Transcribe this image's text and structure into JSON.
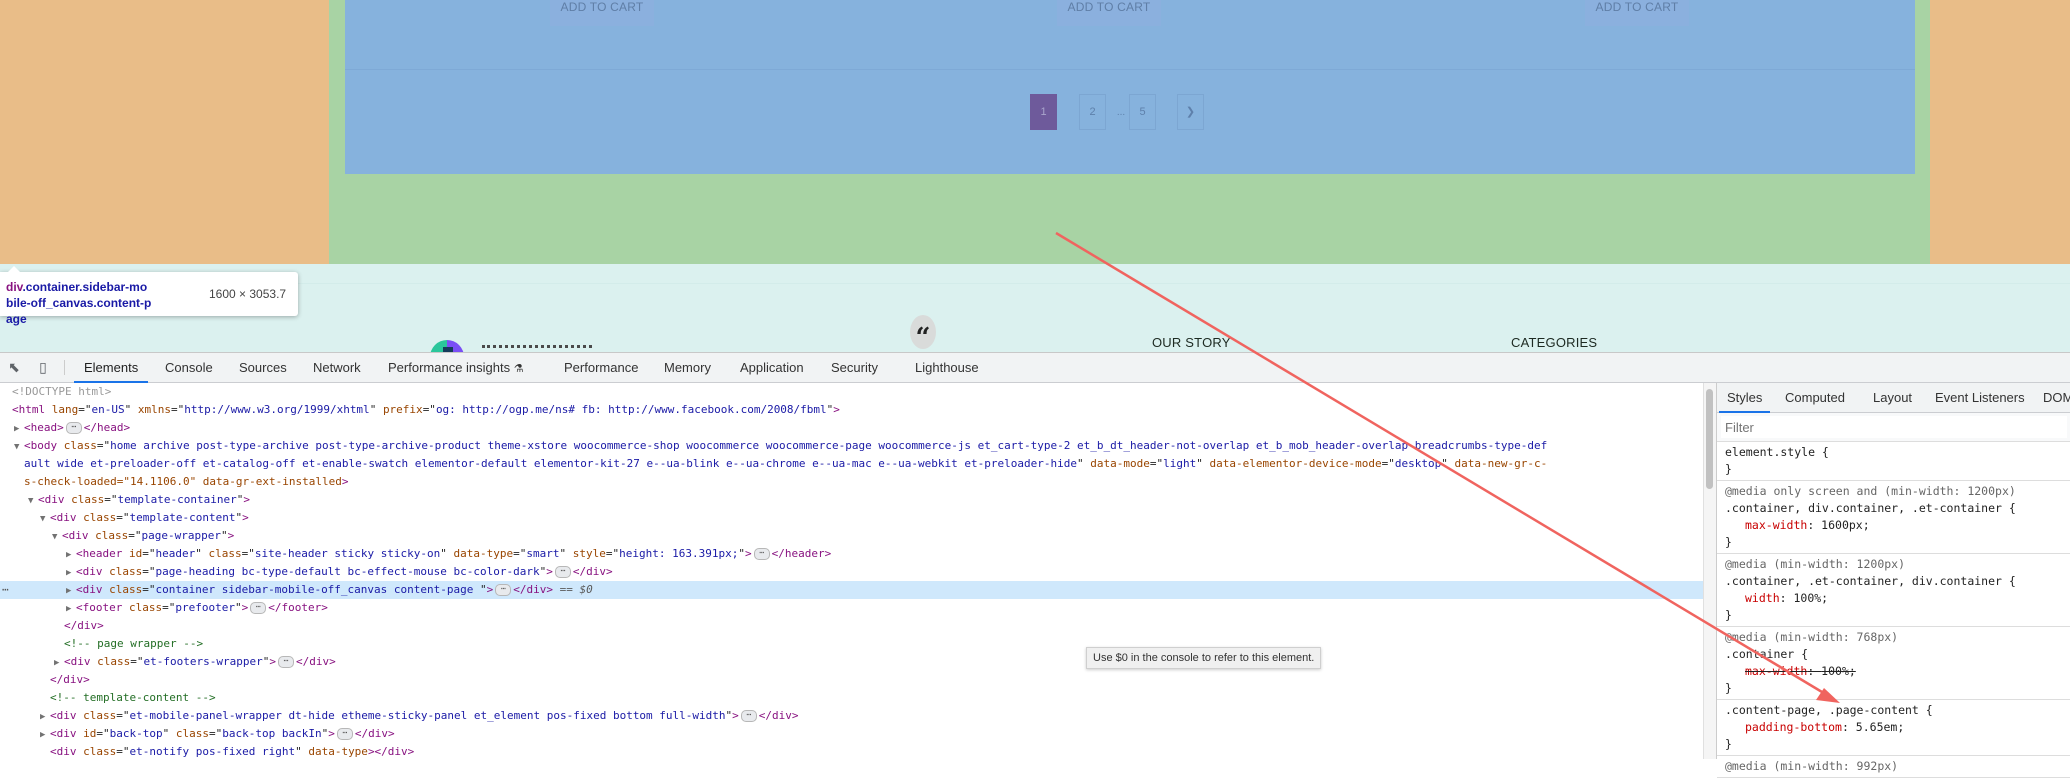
{
  "page": {
    "add_to_cart_label": "ADD TO CART",
    "pagination": {
      "pages": [
        "1",
        "2",
        "5"
      ],
      "ellipsis": "...",
      "current": "1",
      "next_icon": "chevron-right-icon"
    },
    "footer": {
      "quote_icon": "quote-icon",
      "headings": [
        "OUR STORY",
        "CATEGORIES"
      ]
    },
    "box_model_colors": {
      "margin": "#e9bd88",
      "padding": "#a8d3a4",
      "content": "#86b2dd"
    }
  },
  "inspect_tooltip": {
    "tag": "div",
    "classes": ".container.sidebar-mobile-off_canvas.content-page",
    "size": "1600 × 3053.7"
  },
  "devtools": {
    "toolbar_icons": [
      "inspect-element-icon",
      "device-toolbar-icon"
    ],
    "tabs": [
      "Elements",
      "Console",
      "Sources",
      "Network",
      "Performance insights",
      "Performance",
      "Memory",
      "Application",
      "Security",
      "Lighthouse"
    ],
    "active_tab": "Elements",
    "perf_insights_icon": "flask-icon",
    "dom": {
      "doctype": "<!DOCTYPE html>",
      "html_open": {
        "tag": "html",
        "attrs": [
          [
            "lang",
            "en-US"
          ],
          [
            "xmlns",
            "http://www.w3.org/1999/xhtml"
          ],
          [
            "prefix",
            "og: http://ogp.me/ns# fb: http://www.facebook.com/2008/fbml"
          ]
        ]
      },
      "head": "head",
      "body_class_line1": "home archive post-type-archive post-type-archive-product theme-xstore woocommerce-shop woocommerce woocommerce-page woocommerce-js et_cart-type-2 et_b_dt_header-not-overlap et_b_mob_header-overlap breadcrumbs-type-def",
      "body_class_line2": "ault wide et-preloader-off et-catalog-off et-enable-swatch elementor-default elementor-kit-27 e--ua-blink e--ua-chrome e--ua-mac e--ua-webkit et-preloader-hide",
      "body_attrs_line2": [
        [
          "data-mode",
          "light"
        ],
        [
          "data-elementor-device-mode",
          "desktop"
        ],
        [
          "data-new-gr-c-",
          ""
        ]
      ],
      "body_attrs_line3": "s-check-loaded=\"14.1106.0\" data-gr-ext-installed",
      "template_container": "template-container",
      "template_content": "template-content",
      "page_wrapper": "page-wrapper",
      "header": {
        "id": "header",
        "class": "site-header sticky sticky-on",
        "data_type": "smart",
        "style": "height: 163.391px;"
      },
      "page_heading": "page-heading bc-type-default bc-effect-mouse bc-color-dark",
      "selected_div": "container sidebar-mobile-off_canvas content-page ",
      "selected_marker": "== $0",
      "footer_class": "prefooter",
      "comment_page_wrapper": "<!-- page wrapper -->",
      "footers_wrapper": "et-footers-wrapper",
      "comment_template_content": "<!-- template-content -->",
      "mobile_panel": "et-mobile-panel-wrapper dt-hide etheme-sticky-panel et_element pos-fixed bottom full-width",
      "back_top": {
        "id": "back-top",
        "class": "back-top backIn"
      },
      "notify": {
        "class": "et-notify pos-fixed right",
        "attr": "data-type"
      }
    },
    "styles_pane": {
      "tabs": [
        "Styles",
        "Computed",
        "Layout",
        "Event Listeners",
        "DOM"
      ],
      "active_tab": "Styles",
      "filter_placeholder": "Filter",
      "rules": [
        {
          "media": "",
          "selector": "element.style {",
          "decls": []
        },
        {
          "media": "@media only screen and (min-width: 1200px)",
          "selector": ".container, div.container, .et-container {",
          "decls": [
            {
              "prop": "max-width",
              "value": "1600px;",
              "struck": false
            }
          ]
        },
        {
          "media": "@media (min-width: 1200px)",
          "selector": ".container, .et-container, div.container {",
          "decls": [
            {
              "prop": "width",
              "value": "100%;",
              "struck": false
            }
          ]
        },
        {
          "media": "@media (min-width: 768px)",
          "selector": ".container {",
          "decls": [
            {
              "prop": "max-width",
              "value": "100%;",
              "struck": true
            }
          ]
        },
        {
          "media": "",
          "selector": ".content-page, .page-content {",
          "decls": [
            {
              "prop": "padding-bottom",
              "value": "5.65em;",
              "struck": false
            }
          ]
        },
        {
          "media": "@media (min-width: 992px)",
          "selector": "",
          "decls": []
        }
      ]
    },
    "console_hint": "Use $0 in the console to refer to this element."
  }
}
